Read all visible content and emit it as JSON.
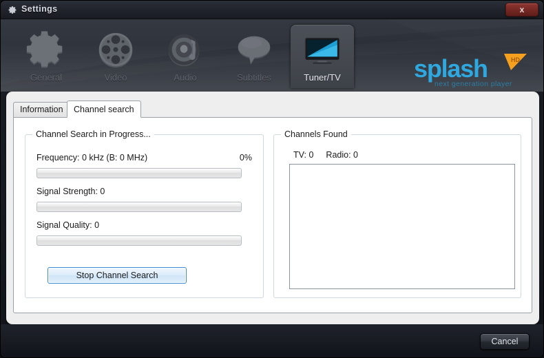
{
  "window": {
    "title": "Settings",
    "title_icon": "gear-icon",
    "close_label": "x"
  },
  "header": {
    "nav": [
      {
        "label": "General",
        "icon": "gear-icon",
        "active": false
      },
      {
        "label": "Video",
        "icon": "film-reel-icon",
        "active": false
      },
      {
        "label": "Audio",
        "icon": "speaker-note-icon",
        "active": false
      },
      {
        "label": "Subtitles",
        "icon": "speech-bubble-icon",
        "active": false
      },
      {
        "label": "Tuner/TV",
        "icon": "tv-monitor-icon",
        "active": true
      }
    ],
    "logo": {
      "name": "splash",
      "tagline": "next generation player",
      "badge": "HD",
      "color": "#2fa8df",
      "badge_color": "#f5a01e"
    }
  },
  "tabs": [
    {
      "label": "Information",
      "active": false
    },
    {
      "label": "Channel search",
      "active": true
    }
  ],
  "channel_search": {
    "group_title": "Channel Search in Progress...",
    "frequency_label": "Frequency: 0 kHz (B: 0 MHz)",
    "percent_label": "0%",
    "progress_percent": 0,
    "signal_strength_label": "Signal Strength: 0",
    "signal_strength_percent": 0,
    "signal_quality_label": "Signal Quality: 0",
    "signal_quality_percent": 0,
    "stop_button_label": "Stop Channel Search"
  },
  "channels_found": {
    "group_title": "Channels Found",
    "tv_label": "TV: 0",
    "radio_label": "Radio: 0",
    "list_items": []
  },
  "footer": {
    "cancel_label": "Cancel"
  }
}
